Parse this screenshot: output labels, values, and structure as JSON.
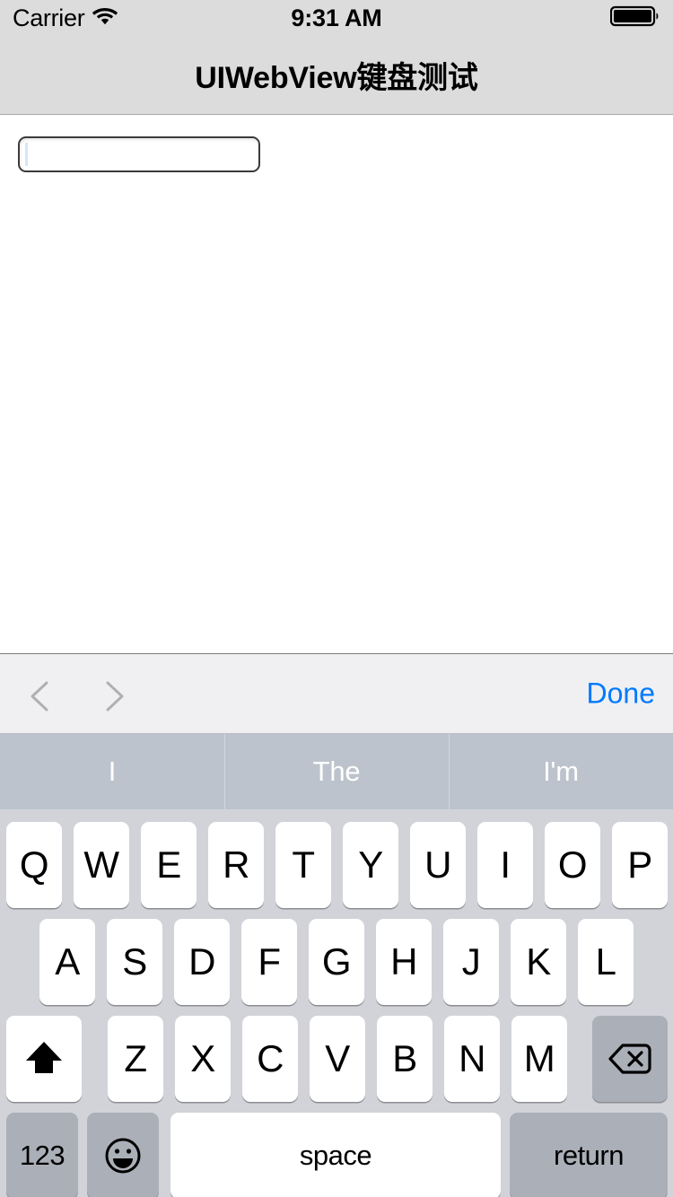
{
  "status_bar": {
    "carrier": "Carrier",
    "wifi_icon": "wifi-icon",
    "time": "9:31 AM",
    "battery_icon": "battery-full-icon"
  },
  "nav_bar": {
    "title": "UIWebView键盘测试"
  },
  "web_content": {
    "text_field": {
      "value": "",
      "placeholder": ""
    }
  },
  "keyboard_toolbar": {
    "prev_icon": "chevron-left-icon",
    "next_icon": "chevron-right-icon",
    "done_label": "Done",
    "done_color": "#007aff",
    "prev_enabled": false,
    "next_enabled": false
  },
  "predictive_bar": {
    "suggestions": [
      "I",
      "The",
      "I'm"
    ]
  },
  "keyboard": {
    "row1": [
      "Q",
      "W",
      "E",
      "R",
      "T",
      "Y",
      "U",
      "I",
      "O",
      "P"
    ],
    "row2": [
      "A",
      "S",
      "D",
      "F",
      "G",
      "H",
      "J",
      "K",
      "L"
    ],
    "row3_letters": [
      "Z",
      "X",
      "C",
      "V",
      "B",
      "N",
      "M"
    ],
    "shift_icon": "shift-icon",
    "backspace_icon": "backspace-icon",
    "numbers_label": "123",
    "emoji_icon": "emoji-smiley-icon",
    "space_label": "space",
    "return_label": "return"
  },
  "colors": {
    "keyboard_background": "#d1d3d9",
    "key_white": "#ffffff",
    "key_gray": "#abafb8",
    "predictive_background": "#bcc3cc",
    "toolbar_background": "#f0f0f2",
    "navbar_background": "#dcdcdc",
    "accent_blue": "#007aff"
  }
}
